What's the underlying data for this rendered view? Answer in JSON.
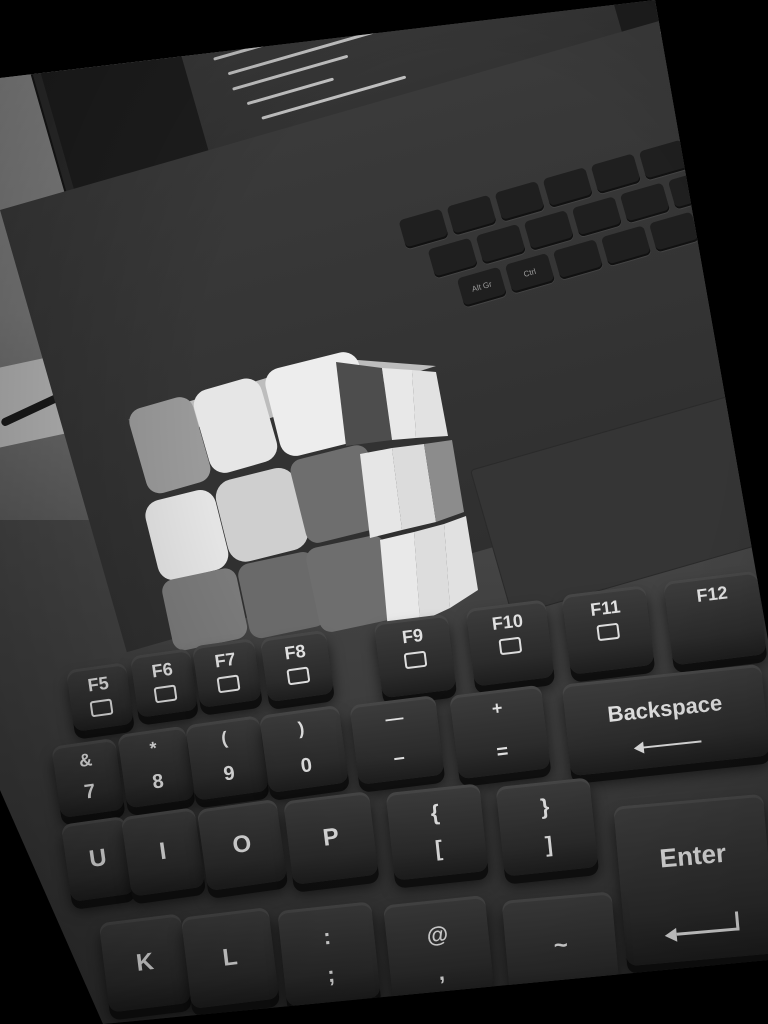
{
  "scene": {
    "palette": {
      "background": "#000000",
      "key_color": "#2b2b2b",
      "legend_color": "#e0e0e0",
      "cube_light": "#e8e8e8",
      "cube_mid": "#9a9a9a",
      "cube_dark": "#555555"
    },
    "keyboard": {
      "function_row": [
        {
          "label": "F5",
          "icon": "play-media-icon"
        },
        {
          "label": "F6",
          "icon": "next-track-icon"
        },
        {
          "label": "F7",
          "icon": "pause-media-icon"
        },
        {
          "label": "F8",
          "icon": "stop-media-icon"
        },
        {
          "label": "F9",
          "icon": "mute-icon"
        },
        {
          "label": "F10",
          "icon": "volume-down-icon"
        },
        {
          "label": "F11",
          "icon": "volume-up-icon"
        },
        {
          "label": "F12",
          "icon": ""
        }
      ],
      "number_row": [
        {
          "top": "&",
          "bottom": "7"
        },
        {
          "top": "*",
          "bottom": "8"
        },
        {
          "top": "(",
          "bottom": "9"
        },
        {
          "top": ")",
          "bottom": "0"
        },
        {
          "top": "—",
          "bottom": "–"
        },
        {
          "top": "+",
          "bottom": "="
        }
      ],
      "backspace_label": "Backspace",
      "letter_row": [
        {
          "label": "U"
        },
        {
          "label": "I"
        },
        {
          "label": "O"
        },
        {
          "label": "P"
        },
        {
          "top": "{",
          "bottom": "["
        },
        {
          "top": "}",
          "bottom": "]"
        }
      ],
      "enter_label": "Enter",
      "home_row": [
        {
          "label": "K"
        },
        {
          "label": "L"
        },
        {
          "top": ":",
          "bottom": ";"
        },
        {
          "top": "@",
          "bottom": ","
        },
        {
          "label": "~"
        }
      ]
    },
    "laptop_keys": [
      "Alt Gr",
      "Ctrl"
    ]
  }
}
